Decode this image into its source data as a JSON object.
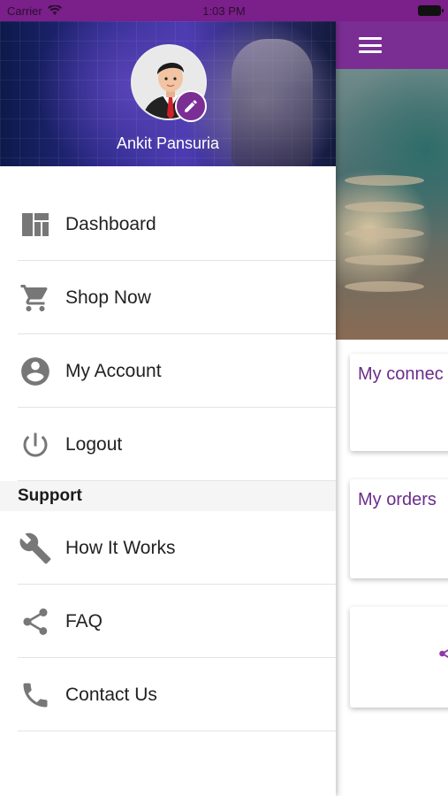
{
  "status_bar": {
    "carrier": "Carrier",
    "time": "1:03 PM"
  },
  "drawer": {
    "user_name": "Ankit Pansuria",
    "menu_items": [
      {
        "label": "Dashboard",
        "icon": "dashboard-icon"
      },
      {
        "label": "Shop Now",
        "icon": "cart-icon"
      },
      {
        "label": "My Account",
        "icon": "account-circle-icon"
      },
      {
        "label": "Logout",
        "icon": "power-icon"
      }
    ],
    "support_header": "Support",
    "support_items": [
      {
        "label": "How It Works",
        "icon": "wrench-icon"
      },
      {
        "label": "FAQ",
        "icon": "share-icon"
      },
      {
        "label": "Contact Us",
        "icon": "phone-icon"
      }
    ]
  },
  "main": {
    "cards": [
      "My connec",
      "My orders"
    ]
  },
  "colors": {
    "primary": "#7a2e93",
    "status_bar": "#7b1f8a",
    "card_text": "#6b2c8c"
  }
}
